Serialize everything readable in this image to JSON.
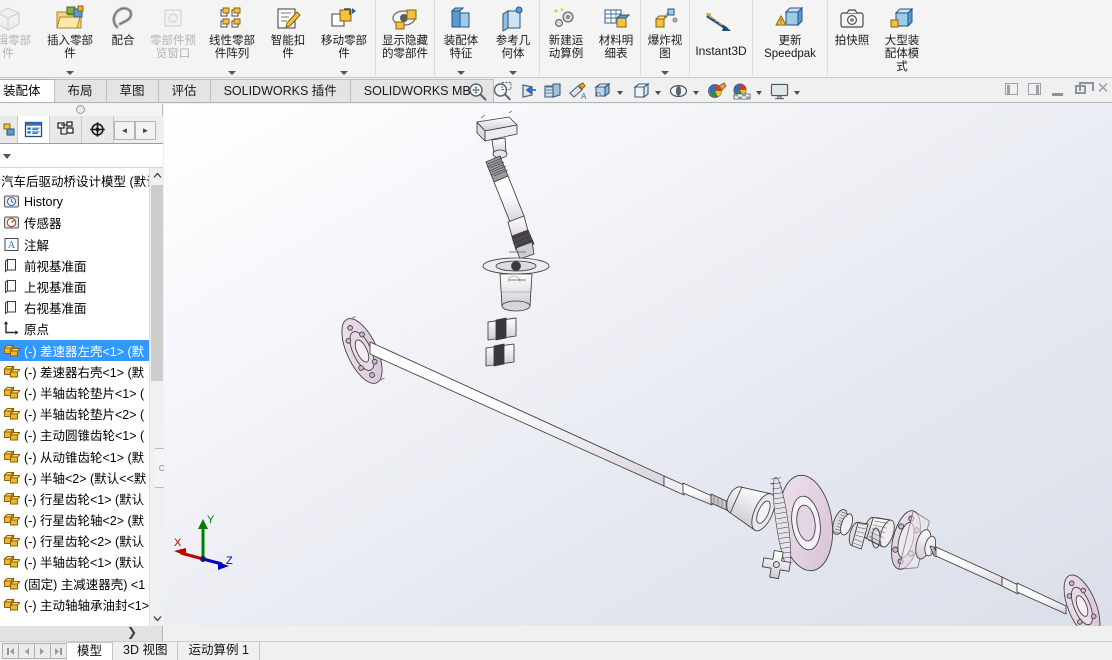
{
  "ribbon": {
    "groups": [
      {
        "buttons": [
          {
            "label": "编辑零部件",
            "icon": "edit-component-icon",
            "disabled": true,
            "clipped": true,
            "caret": false
          },
          {
            "label": "插入零部件",
            "icon": "insert-component-icon",
            "disabled": false,
            "caret": true
          },
          {
            "label": "配合",
            "icon": "mate-icon",
            "disabled": false,
            "caret": false
          },
          {
            "label": "零部件预览窗口",
            "icon": "component-preview-icon",
            "disabled": true,
            "caret": false
          },
          {
            "label": "线性零部件阵列",
            "icon": "linear-component-pattern-icon",
            "disabled": false,
            "caret": true
          },
          {
            "label": "智能扣件",
            "icon": "smart-fasteners-icon",
            "disabled": false,
            "caret": false
          },
          {
            "label": "移动零部件",
            "icon": "move-component-icon",
            "disabled": false,
            "caret": true
          }
        ]
      },
      {
        "buttons": [
          {
            "label": "显示隐藏的零部件",
            "icon": "show-hidden-components-icon",
            "disabled": false,
            "caret": false
          }
        ]
      },
      {
        "buttons": [
          {
            "label": "装配体特征",
            "icon": "assembly-features-icon",
            "disabled": false,
            "caret": true
          },
          {
            "label": "参考几何体",
            "icon": "reference-geometry-icon",
            "disabled": false,
            "caret": true
          }
        ]
      },
      {
        "buttons": [
          {
            "label": "新建运动算例",
            "icon": "new-motion-study-icon",
            "disabled": false,
            "caret": false
          },
          {
            "label": "材料明细表",
            "icon": "bill-of-materials-icon",
            "disabled": false,
            "caret": false
          }
        ]
      },
      {
        "buttons": [
          {
            "label": "爆炸视图",
            "icon": "exploded-view-icon",
            "disabled": false,
            "caret": true
          }
        ]
      },
      {
        "buttons": [
          {
            "label": "Instant3D",
            "icon": "instant3d-icon",
            "disabled": false,
            "caret": false
          }
        ]
      },
      {
        "buttons": [
          {
            "label": "更新 Speedpak",
            "icon": "update-speedpak-icon",
            "disabled": false,
            "caret": false
          }
        ]
      },
      {
        "buttons": [
          {
            "label": "拍快照",
            "icon": "snapshot-icon",
            "disabled": false,
            "caret": false
          },
          {
            "label": "大型装配体模式",
            "icon": "large-assembly-mode-icon",
            "disabled": false,
            "caret": false
          }
        ]
      }
    ]
  },
  "tabs": {
    "items": [
      {
        "label": "装配体",
        "active": true
      },
      {
        "label": "布局",
        "active": false
      },
      {
        "label": "草图",
        "active": false
      },
      {
        "label": "评估",
        "active": false
      },
      {
        "label": "SOLIDWORKS 插件",
        "active": false
      },
      {
        "label": "SOLIDWORKS MBD",
        "active": false
      }
    ]
  },
  "view_toolbar": {
    "items": [
      {
        "name": "zoom-to-fit-icon",
        "caret": false
      },
      {
        "name": "zoom-to-area-icon",
        "caret": false
      },
      {
        "name": "previous-view-icon",
        "caret": false
      },
      {
        "name": "section-view-icon",
        "caret": false
      },
      {
        "name": "view-orientation-paint-icon",
        "caret": false
      },
      {
        "name": "view-orientation-icon",
        "caret": true
      },
      {
        "name": "display-style-icon",
        "caret": true
      },
      {
        "name": "hide-show-items-icon",
        "caret": true
      },
      {
        "name": "edit-appearance-icon",
        "caret": false
      },
      {
        "name": "apply-scene-icon",
        "caret": true
      },
      {
        "name": "view-settings-icon",
        "caret": true
      }
    ]
  },
  "window_controls": {
    "prev_doc": "prev-document-icon",
    "next_doc": "next-document-icon",
    "minimize": "minimize-icon",
    "restore": "restore-icon",
    "close": "close-icon"
  },
  "left_panel": {
    "tabs": [
      {
        "name": "tab-feature-manager",
        "icon": "feature-manager-tree-icon",
        "active": true
      },
      {
        "name": "tab-property-manager",
        "icon": "property-manager-icon",
        "active": false
      },
      {
        "name": "tab-configuration-manager",
        "icon": "configuration-manager-icon",
        "active": false
      },
      {
        "name": "tab-display-manager",
        "icon": "display-manager-icon",
        "active": false
      }
    ],
    "nav_prev": "◄",
    "nav_next": "►",
    "tree": [
      {
        "label": "汽车后驱动桥设计模型  (默认",
        "icon": "assembly-icon",
        "root": true,
        "selected": false
      },
      {
        "label": "History",
        "icon": "history-icon",
        "selected": false
      },
      {
        "label": "传感器",
        "icon": "sensors-icon",
        "selected": false
      },
      {
        "label": "注解",
        "icon": "annotations-icon",
        "selected": false
      },
      {
        "label": "前视基准面",
        "icon": "plane-icon",
        "selected": false
      },
      {
        "label": "上视基准面",
        "icon": "plane-icon",
        "selected": false
      },
      {
        "label": "右视基准面",
        "icon": "plane-icon",
        "selected": false
      },
      {
        "label": "原点",
        "icon": "origin-icon",
        "selected": false
      },
      {
        "label": "(-) 差速器左壳<1> (默",
        "icon": "component-icon",
        "selected": true
      },
      {
        "label": "(-) 差速器右壳<1> (默",
        "icon": "component-icon",
        "selected": false
      },
      {
        "label": "(-) 半轴齿轮垫片<1> (",
        "icon": "component-icon",
        "selected": false
      },
      {
        "label": "(-) 半轴齿轮垫片<2> (",
        "icon": "component-icon",
        "selected": false
      },
      {
        "label": "(-) 主动圆锥齿轮<1> (",
        "icon": "component-icon",
        "selected": false
      },
      {
        "label": "(-) 从动锥齿轮<1> (默",
        "icon": "component-icon",
        "selected": false
      },
      {
        "label": "(-) 半轴<2> (默认<<默",
        "icon": "component-icon",
        "selected": false
      },
      {
        "label": "(-) 行星齿轮<1> (默认",
        "icon": "component-icon",
        "selected": false
      },
      {
        "label": "(-) 行星齿轮轴<2> (默",
        "icon": "component-icon",
        "selected": false
      },
      {
        "label": "(-) 行星齿轮<2> (默认",
        "icon": "component-icon",
        "selected": false
      },
      {
        "label": "(-) 半轴齿轮<1> (默认",
        "icon": "component-icon",
        "selected": false
      },
      {
        "label": "(固定) 主减速器壳)  <1",
        "icon": "component-icon",
        "selected": false
      },
      {
        "label": "(-) 主动轴轴承油封<1>",
        "icon": "component-icon",
        "selected": false
      }
    ],
    "scroll_up": "⌃",
    "scroll_down": "⌄"
  },
  "viewport": {
    "triad_labels": {
      "x": "X",
      "y": "Y",
      "z": "Z"
    },
    "triad_colors": {
      "x": "#c00000",
      "y": "#008000",
      "z": "#0000c0"
    },
    "model_colors": {
      "flange": "#e2cfe0",
      "body": "#f5f2f6",
      "outline": "#404040"
    }
  },
  "statusbar": {
    "nav_buttons": [
      "first-tab-icon",
      "prev-tab-icon",
      "next-tab-icon",
      "last-tab-icon"
    ],
    "tabs": [
      {
        "label": "模型",
        "active": true
      },
      {
        "label": "3D 视图",
        "active": false
      },
      {
        "label": "运动算例 1",
        "active": false
      }
    ]
  }
}
